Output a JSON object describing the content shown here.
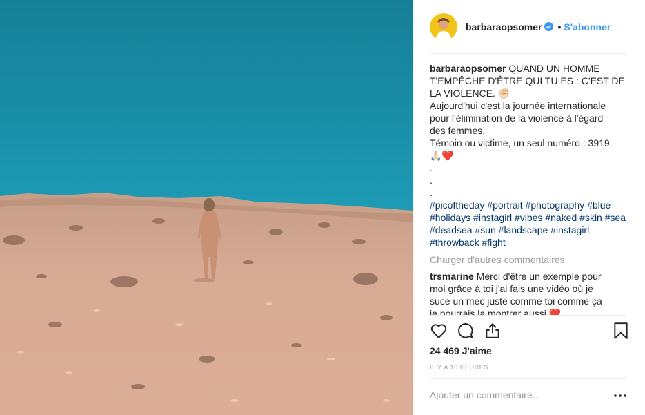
{
  "post": {
    "username": "barbaraopsomer",
    "follow_label": "S'abonner",
    "caption_username": "barbaraopsomer",
    "caption_lines": [
      "QUAND UN HOMME",
      "T'EMPÊCHE D'ÊTRE QUI TU ES : C'EST DE",
      "LA VIOLENCE. ✊🏻",
      "Aujourd'hui c'est la journée internationale",
      "pour l'élimination de la violence à l'égard",
      "des femmes.",
      "Témoin ou victime, un seul numéro : 3919.",
      "🙏🏻❤️",
      ".",
      ".",
      "."
    ],
    "hashtags": [
      "#picoftheday",
      "#portrait",
      "#photography",
      "#blue",
      "#holidays",
      "#instagirl",
      "#vibes",
      "#naked",
      "#skin",
      "#sea",
      "#deadsea",
      "#sun",
      "#landscape",
      "#instagirl",
      "#throwback",
      "#fight"
    ],
    "load_more_label": "Charger d'autres commentaires",
    "comment": {
      "username": "trsmarine",
      "text_lines": [
        "Merci d'être un exemple pour",
        "moi grâce à toi j'ai fais une vidéo où je",
        "suce un mec juste comme toi comme ça",
        "je pourrais la montrer aussi ❤️"
      ]
    },
    "likes_label": "24 469 J'aime",
    "time_label": "IL Y A 16 HEURES",
    "add_comment_placeholder": "Ajouter un commentaire...",
    "icons": {
      "like": "heart-outline-icon",
      "comment": "comment-bubble-icon",
      "share": "share-icon",
      "save": "bookmark-icon",
      "verified": "verified-badge-icon",
      "more": "more-options-icon"
    },
    "colors": {
      "link": "#3897f0",
      "hashtag": "#003569",
      "muted": "#999999",
      "sky": "#1e9ab5",
      "sand": "#d9ab95"
    }
  }
}
